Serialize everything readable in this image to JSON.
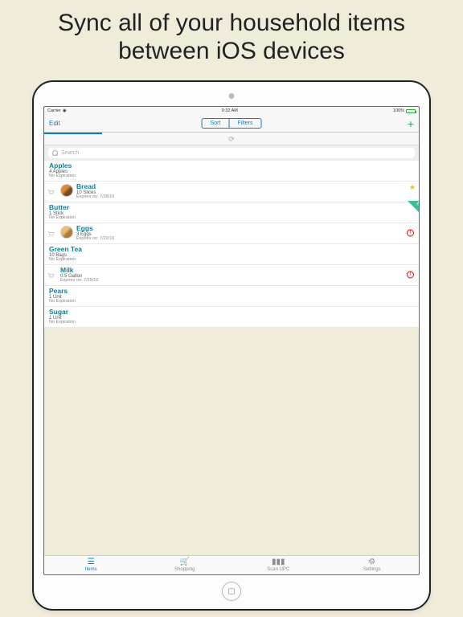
{
  "headline": "Sync all of your household items between iOS devices",
  "status": {
    "carrier": "Carrier",
    "time": "9:32 AM",
    "battery": "100%"
  },
  "nav": {
    "edit": "Edit",
    "sort": "Sort",
    "filters": "Filters",
    "add": "+"
  },
  "search": {
    "placeholder": "Search"
  },
  "items": [
    {
      "name": "Apples",
      "qty": "4 Apples",
      "exp": "No Expiration"
    },
    {
      "name": "Bread",
      "qty": "10 Slices",
      "exp": "Expires on: 7/28/16",
      "indented": true,
      "thumb": "bread",
      "star": true
    },
    {
      "name": "Butter",
      "qty": "1 Stick",
      "exp": "No Expiration",
      "ribbon": "E"
    },
    {
      "name": "Eggs",
      "qty": "3 Eggs",
      "exp": "Expires on: 7/22/16",
      "indented": true,
      "thumb": "egg",
      "warn": true
    },
    {
      "name": "Green Tea",
      "qty": "10 Bags",
      "exp": "No Expiration"
    },
    {
      "name": "Milk",
      "qty": "0.5 Gallon",
      "exp": "Expires on: 7/25/16",
      "indented": true,
      "warn": true
    },
    {
      "name": "Pears",
      "qty": "1 Unit",
      "exp": "No Expiration"
    },
    {
      "name": "Sugar",
      "qty": "1 Unit",
      "exp": "No Expiration"
    }
  ],
  "tabs": {
    "items": "Items",
    "shopping": "Shopping",
    "scan": "Scan UPC",
    "settings": "Settings"
  }
}
